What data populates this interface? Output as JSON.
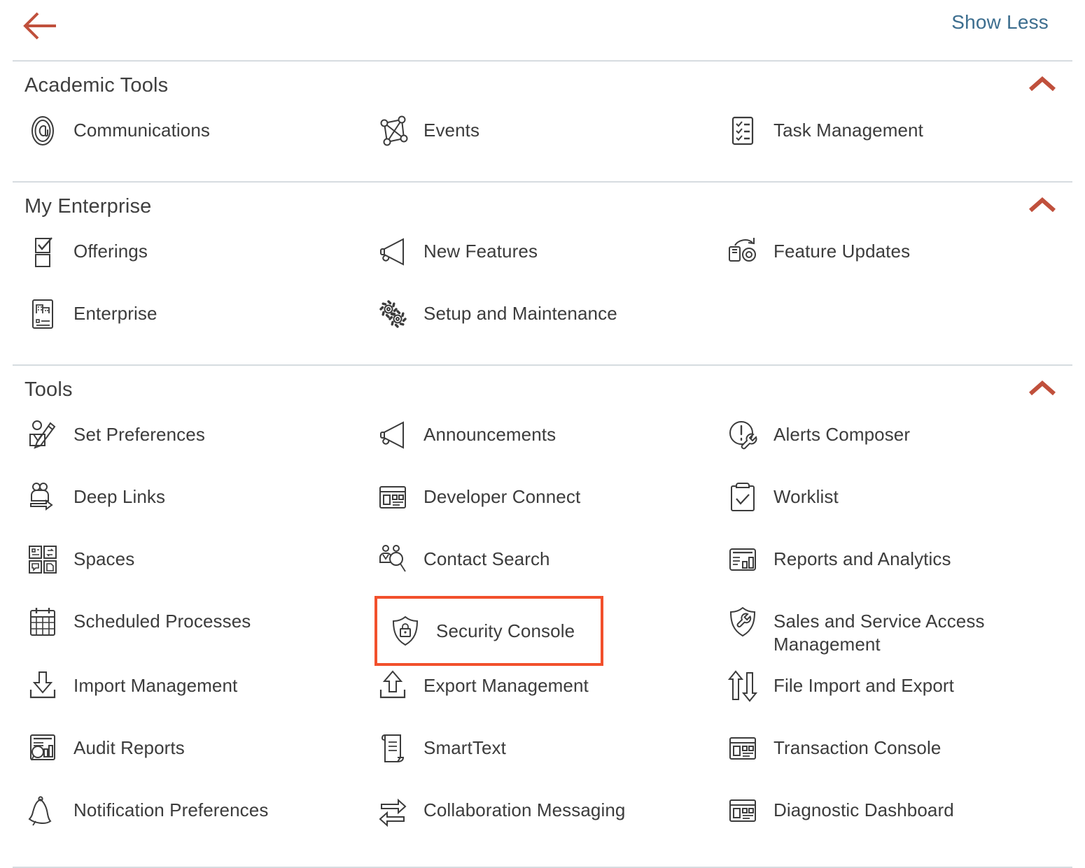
{
  "header": {
    "back_icon": "back-arrow-icon",
    "show_less_label": "Show Less"
  },
  "collapse_icon": "chevron-up-icon",
  "sections": [
    {
      "title": "Academic Tools",
      "items": [
        {
          "label": "Communications",
          "icon": "at-sign-circle-icon"
        },
        {
          "label": "Events",
          "icon": "network-graph-icon"
        },
        {
          "label": "Task Management",
          "icon": "checklist-icon"
        }
      ]
    },
    {
      "title": "My Enterprise",
      "items": [
        {
          "label": "Offerings",
          "icon": "checkbox-stack-icon"
        },
        {
          "label": "New Features",
          "icon": "megaphone-icon"
        },
        {
          "label": "Feature Updates",
          "icon": "device-refresh-icon"
        },
        {
          "label": "Enterprise",
          "icon": "office-building-icon"
        },
        {
          "label": "Setup and Maintenance",
          "icon": "gears-icon"
        },
        {
          "label": "",
          "icon": ""
        }
      ]
    },
    {
      "title": "Tools",
      "items": [
        {
          "label": "Set Preferences",
          "icon": "person-pencil-icon"
        },
        {
          "label": "Announcements",
          "icon": "megaphone-icon"
        },
        {
          "label": "Alerts Composer",
          "icon": "alert-wrench-icon"
        },
        {
          "label": "Deep Links",
          "icon": "people-arrow-icon"
        },
        {
          "label": "Developer Connect",
          "icon": "browser-window-icon"
        },
        {
          "label": "Worklist",
          "icon": "clipboard-check-icon"
        },
        {
          "label": "Spaces",
          "icon": "four-panels-icon"
        },
        {
          "label": "Contact Search",
          "icon": "people-magnifier-icon"
        },
        {
          "label": "Reports and Analytics",
          "icon": "report-chart-icon"
        },
        {
          "label": "Scheduled Processes",
          "icon": "calendar-grid-icon"
        },
        {
          "label": "Security Console",
          "icon": "shield-lock-icon",
          "highlighted": true
        },
        {
          "label": "Sales and Service Access Management",
          "icon": "shield-wrench-icon"
        },
        {
          "label": "Import Management",
          "icon": "download-tray-icon"
        },
        {
          "label": "Export Management",
          "icon": "upload-tray-icon"
        },
        {
          "label": "File Import and Export",
          "icon": "up-down-arrows-icon"
        },
        {
          "label": "Audit Reports",
          "icon": "audit-chart-icon"
        },
        {
          "label": "SmartText",
          "icon": "scroll-document-icon"
        },
        {
          "label": "Transaction Console",
          "icon": "browser-window-icon"
        },
        {
          "label": "Notification Preferences",
          "icon": "bell-icon"
        },
        {
          "label": "Collaboration Messaging",
          "icon": "exchange-arrows-icon"
        },
        {
          "label": "Diagnostic Dashboard",
          "icon": "browser-window-icon"
        }
      ]
    }
  ],
  "colors": {
    "accent_red": "#c0503c",
    "highlight_red": "#f2502c",
    "link_blue": "#3d6e8f",
    "divider": "#d6dce0",
    "icon_stroke": "#3c3c3c"
  }
}
